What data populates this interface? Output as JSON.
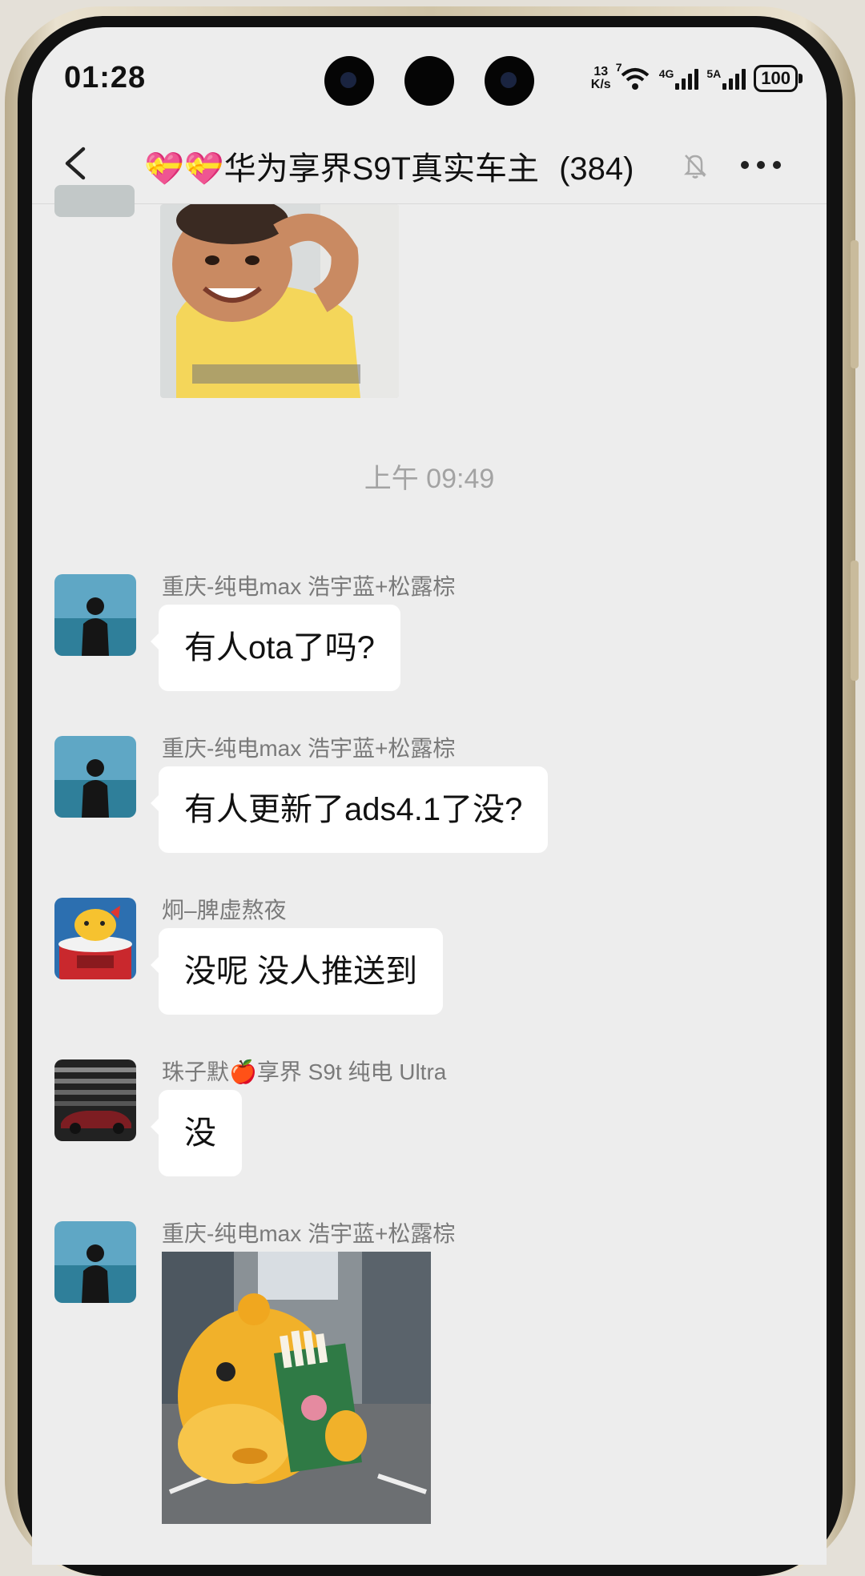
{
  "status_bar": {
    "time": "01:28",
    "net_speed_value": "13",
    "net_speed_unit": "K/s",
    "wifi_badge": "7",
    "signal1_label": "4G",
    "signal2_label": "5A",
    "battery": "100"
  },
  "header": {
    "hearts": "💝💝",
    "title": "华为享界S9T真实车主",
    "member_count": "(384)"
  },
  "chat": {
    "timestamp": "上午 09:49",
    "messages": [
      {
        "sender": "重庆-纯电max 浩宇蓝+松露棕",
        "text": "有人ota了吗?"
      },
      {
        "sender": "重庆-纯电max 浩宇蓝+松露棕",
        "text": "有人更新了ads4.1了没?"
      },
      {
        "sender": "炯–脾虚熬夜",
        "text": "没呢 没人推送到"
      },
      {
        "sender": "珠子默🍎享界 S9t 纯电 Ultra",
        "text": "没"
      },
      {
        "sender": "重庆-纯电max 浩宇蓝+松露棕",
        "text": ""
      }
    ]
  },
  "colors": {
    "background": "#ededed",
    "bubble": "#ffffff",
    "sender_text": "#7a7a7a",
    "timestamp_text": "#a3a3a3"
  }
}
